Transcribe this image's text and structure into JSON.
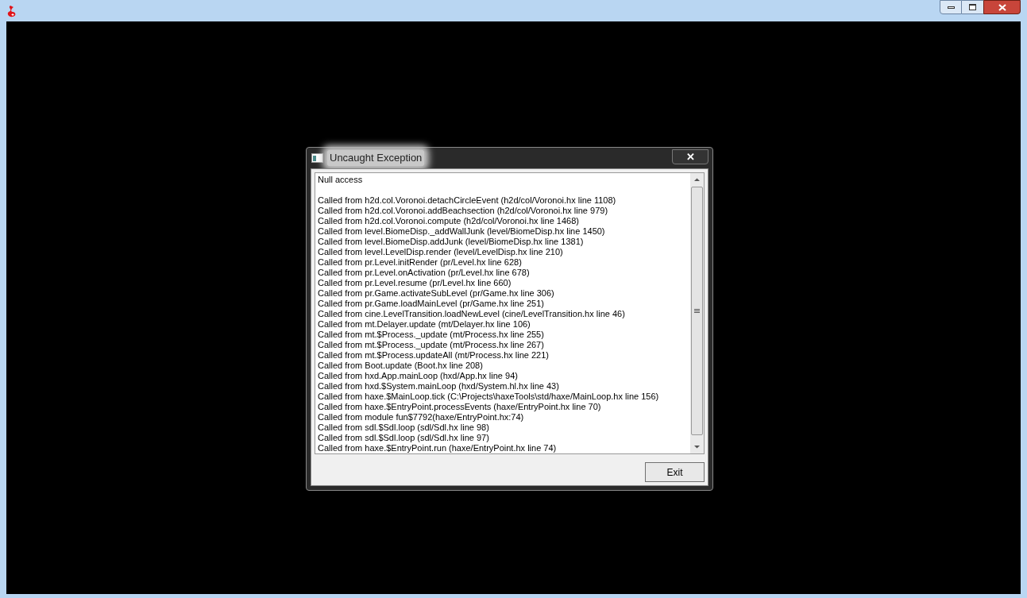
{
  "dialog": {
    "title": "Uncaught Exception",
    "message": "Null access",
    "trace": [
      "Called from h2d.col.Voronoi.detachCircleEvent (h2d/col/Voronoi.hx line 1108)",
      "Called from h2d.col.Voronoi.addBeachsection (h2d/col/Voronoi.hx line 979)",
      "Called from h2d.col.Voronoi.compute (h2d/col/Voronoi.hx line 1468)",
      "Called from level.BiomeDisp._addWallJunk (level/BiomeDisp.hx line 1450)",
      "Called from level.BiomeDisp.addJunk (level/BiomeDisp.hx line 1381)",
      "Called from level.LevelDisp.render (level/LevelDisp.hx line 210)",
      "Called from pr.Level.initRender (pr/Level.hx line 628)",
      "Called from pr.Level.onActivation (pr/Level.hx line 678)",
      "Called from pr.Level.resume (pr/Level.hx line 660)",
      "Called from pr.Game.activateSubLevel (pr/Game.hx line 306)",
      "Called from pr.Game.loadMainLevel (pr/Game.hx line 251)",
      "Called from cine.LevelTransition.loadNewLevel (cine/LevelTransition.hx line 46)",
      "Called from mt.Delayer.update (mt/Delayer.hx line 106)",
      "Called from mt.$Process._update (mt/Process.hx line 255)",
      "Called from mt.$Process._update (mt/Process.hx line 267)",
      "Called from mt.$Process.updateAll (mt/Process.hx line 221)",
      "Called from Boot.update (Boot.hx line 208)",
      "Called from hxd.App.mainLoop (hxd/App.hx line 94)",
      "Called from hxd.$System.mainLoop (hxd/System.hl.hx line 43)",
      "Called from haxe.$MainLoop.tick (C:\\Projects\\haxeTools\\std/haxe/MainLoop.hx line 156)",
      "Called from haxe.$EntryPoint.processEvents (haxe/EntryPoint.hx line 70)",
      "Called from module fun$7792(haxe/EntryPoint.hx:74)",
      "Called from sdl.$Sdl.loop (sdl/Sdl.hx line 98)",
      "Called from sdl.$Sdl.loop (sdl/Sdl.hx line 97)",
      "Called from haxe.$EntryPoint.run (haxe/EntryPoint.hx line 74)"
    ],
    "close_symbol": "✕",
    "button": "Exit"
  }
}
